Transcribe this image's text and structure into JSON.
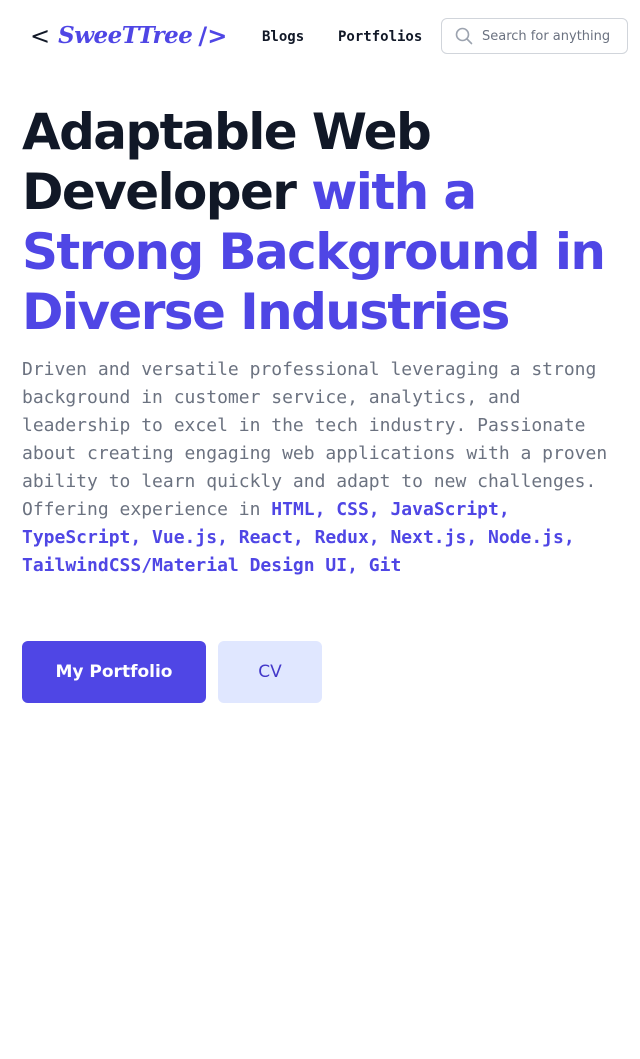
{
  "header": {
    "logo": {
      "open_bracket": "<",
      "name": "SweeTTree",
      "close_bracket": "/>"
    },
    "nav": {
      "blogs": "Blogs",
      "portfolios": "Portfolios"
    },
    "search": {
      "placeholder": "Search for anything",
      "value": ""
    }
  },
  "hero": {
    "title_plain": "Adaptable Web Developer",
    "title_accent": "with a Strong Background in Diverse Industries",
    "description": "Driven and versatile professional leveraging a strong background in customer service, analytics, and leadership to excel in the tech industry. Passionate about creating engaging web applications with a proven ability to learn quickly and adapt to new challenges. Offering experience in",
    "skills": "HTML, CSS, JavaScript, TypeScript, Vue.js, React, Redux, Next.js, Node.js, TailwindCSS/Material Design UI, Git"
  },
  "actions": {
    "portfolio_label": "My Portfolio",
    "cv_label": "CV"
  },
  "colors": {
    "accent": "#4f46e5",
    "heading": "#111827",
    "body_text": "#6b7280",
    "secondary_button_bg": "#e0e7ff"
  },
  "icons": {
    "search": "search-icon"
  }
}
